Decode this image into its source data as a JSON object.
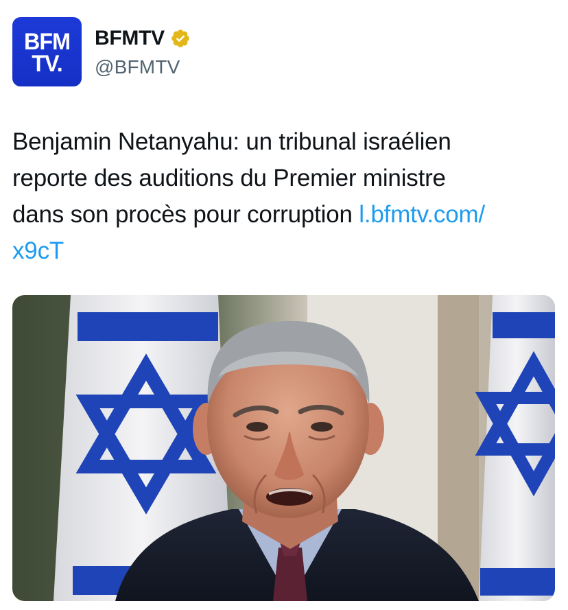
{
  "account": {
    "avatar_text_line1": "BFM",
    "avatar_text_line2": "TV.",
    "display_name": "BFMTV",
    "handle": "@BFMTV",
    "verified": true,
    "verified_icon": "gold-verified-badge-icon",
    "brand_color": "#1d3ad8"
  },
  "tweet": {
    "text_line1": "Benjamin Netanyahu: un tribunal israélien",
    "text_line2": "reporte des auditions du Premier ministre",
    "text_line3": "dans son procès pour corruption ",
    "link_part1": "l.bfmtv.com/",
    "link_part2": "x9cT",
    "link_color": "#1d9bf0"
  },
  "media": {
    "kind": "photo"
  }
}
